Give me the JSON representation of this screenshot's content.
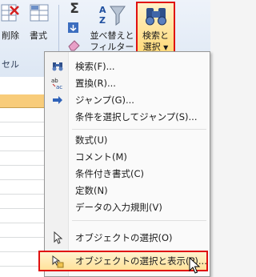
{
  "ribbon": {
    "delete_label": "削除",
    "format_label": "書式",
    "cells_group_label": "セル",
    "sigma_glyph": "Σ",
    "sort_label_1": "並べ替えと",
    "sort_label_2": "フィルター",
    "find_label_1": "検索と",
    "find_label_2": "選択"
  },
  "menu": {
    "items": [
      {
        "label": "検索(F)...",
        "icon": "binoculars-icon"
      },
      {
        "label": "置換(R)...",
        "icon": "replace-icon"
      },
      {
        "label": "ジャンプ(G)...",
        "icon": "arrow-right-icon"
      },
      {
        "label": "条件を選択してジャンプ(S)...",
        "icon": ""
      },
      {
        "label": "数式(U)",
        "icon": ""
      },
      {
        "label": "コメント(M)",
        "icon": ""
      },
      {
        "label": "条件付き書式(C)",
        "icon": ""
      },
      {
        "label": "定数(N)",
        "icon": ""
      },
      {
        "label": "データの入力規則(V)",
        "icon": ""
      },
      {
        "label": "オブジェクトの選択(O)",
        "icon": "pointer-icon"
      },
      {
        "label": "オブジェクトの選択と表示(P)...",
        "icon": "selection-pane-icon"
      }
    ]
  },
  "colors": {
    "highlight_border": "#e01010",
    "hover_fill": "#ffe29a",
    "selected_header": "#f8cc7a"
  }
}
